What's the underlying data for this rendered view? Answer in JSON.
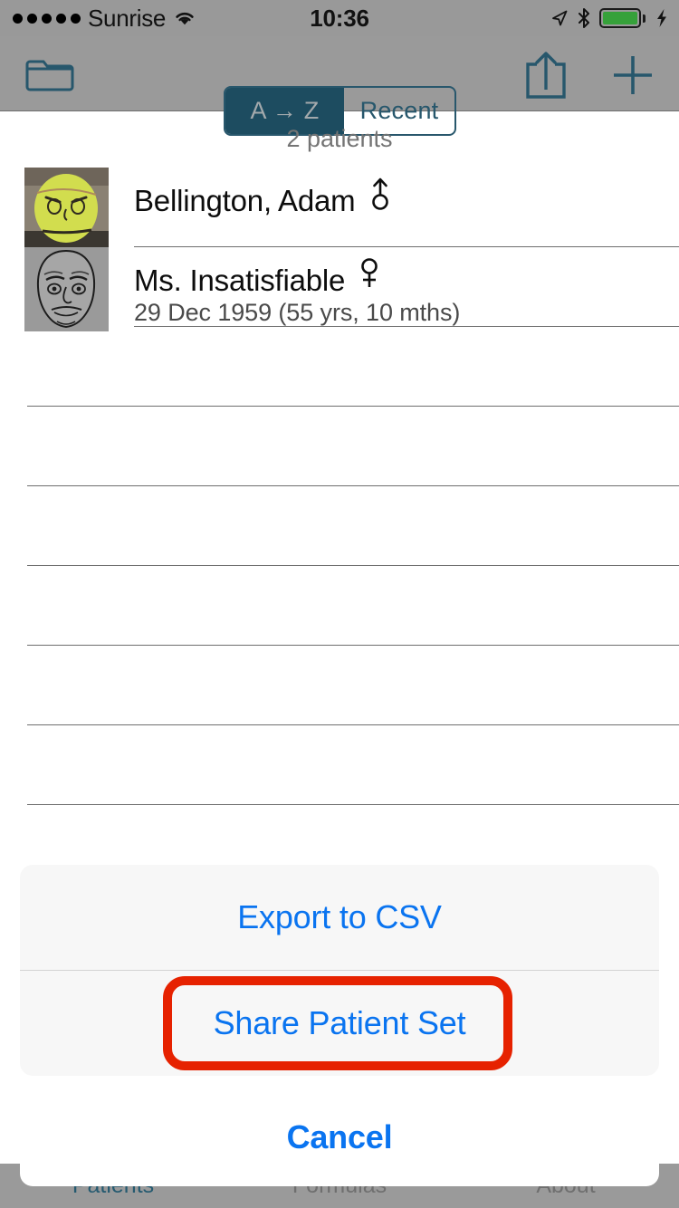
{
  "status_bar": {
    "signal_dots": 5,
    "carrier": "Sunrise",
    "wifi_icon": "wifi-icon",
    "time": "10:36",
    "location_icon": "location-arrow-icon",
    "bluetooth_icon": "bluetooth-icon",
    "battery_icon": "battery-full-icon",
    "battery_level_pct": 100,
    "battery_color": "#36a13a",
    "charging_icon": "lightning-bolt-icon"
  },
  "nav_bar": {
    "folder_icon": "folder-icon",
    "share_icon": "share-upload-icon",
    "add_icon": "plus-icon",
    "segmented": {
      "options": [
        {
          "label": "A → Z",
          "selected": true
        },
        {
          "label": "Recent",
          "selected": false
        }
      ],
      "selected_bg": "#1d4c60",
      "selected_text": "#a3a9ac",
      "unselected_text": "#27576c"
    }
  },
  "list": {
    "header": "2 patients",
    "patients": [
      {
        "name": "Bellington, Adam",
        "gender": "male",
        "gender_icon": "male-symbol-icon",
        "avatar": "tennis-ball-face-photo",
        "dob": ""
      },
      {
        "name": "Ms. Insatisfiable",
        "gender": "female",
        "gender_icon": "female-symbol-icon",
        "avatar": "sketched-face-drawing",
        "dob": "29 Dec 1959  (55 yrs, 10 mths)"
      }
    ],
    "empty_rows": 6
  },
  "tab_bar": {
    "tabs": [
      {
        "label": "Patients",
        "active": true
      },
      {
        "label": "Formulas",
        "active": false
      },
      {
        "label": "About",
        "active": false
      }
    ],
    "active_color": "#255a70",
    "inactive_color": "#6f6f6f"
  },
  "action_sheet": {
    "buttons": [
      {
        "label": "Export to CSV"
      },
      {
        "label": "Share Patient Set",
        "highlighted": true
      }
    ],
    "cancel_label": "Cancel",
    "tint_color": "#0a74f0",
    "highlight_color": "#e62200"
  }
}
